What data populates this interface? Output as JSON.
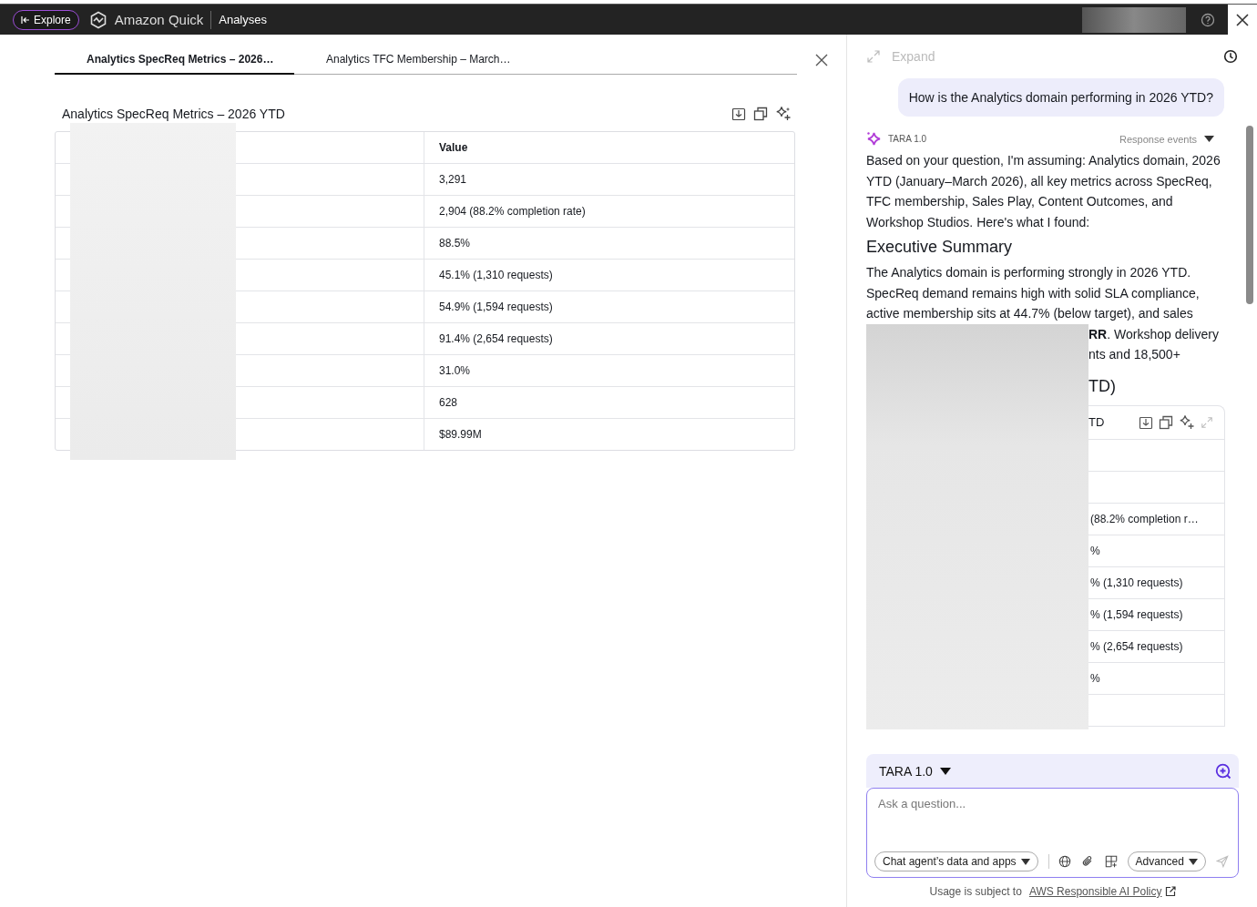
{
  "top_bar": {
    "explore_button": "Explore",
    "app_name": "Amazon Quick",
    "section": "Analyses"
  },
  "tabs": [
    {
      "label": "Analytics SpecReq Metrics – 2026…",
      "selected": true
    },
    {
      "label": "Analytics TFC Membership – March…",
      "selected": false
    }
  ],
  "visual": {
    "title": "Analytics SpecReq Metrics – 2026 YTD",
    "value_column": "Value",
    "values": [
      "3,291",
      "2,904 (88.2% completion rate)",
      "88.5%",
      "45.1% (1,310 requests)",
      "54.9% (1,594 requests)",
      "91.4% (2,654 requests)",
      "31.0%",
      "628",
      "$89.99M"
    ]
  },
  "chat": {
    "expand_label": "Expand",
    "question": "How is the Analytics domain performing in 2026 YTD?",
    "agent_name": "TARA 1.0",
    "response_events": "Response events",
    "intro": "Based on your question, I'm assuming: Analytics domain, 2026 YTD (January–March 2026), all key metrics across SpecReq, TFC membership, Sales Play, Content Outcomes, and Workshop Studios. Here's what I found:",
    "summary_heading": "Executive Summary",
    "summary": "The Analytics domain is performing strongly in 2026 YTD. SpecReq demand remains high with solid SLA compliance, active membership sits at 44.7% (below target), and sales",
    "summary_fragments": [
      "**RR**. Workshop delivery",
      "nts and 18,500+"
    ],
    "section_heading_fragment": "TD)",
    "table_title_fragment": "TD",
    "table_cells": [
      "(88.2% completion r…",
      "%",
      "% (1,310 requests)",
      "% (1,594 requests)",
      "% (2,654 requests)",
      "%"
    ]
  },
  "composer": {
    "agent": "TARA 1.0",
    "placeholder": "Ask a question...",
    "source_button": "Chat agent’s data and apps",
    "advanced_button": "Advanced",
    "usage_text": "Usage is subject to",
    "policy_link": "AWS Responsible AI Policy"
  }
}
